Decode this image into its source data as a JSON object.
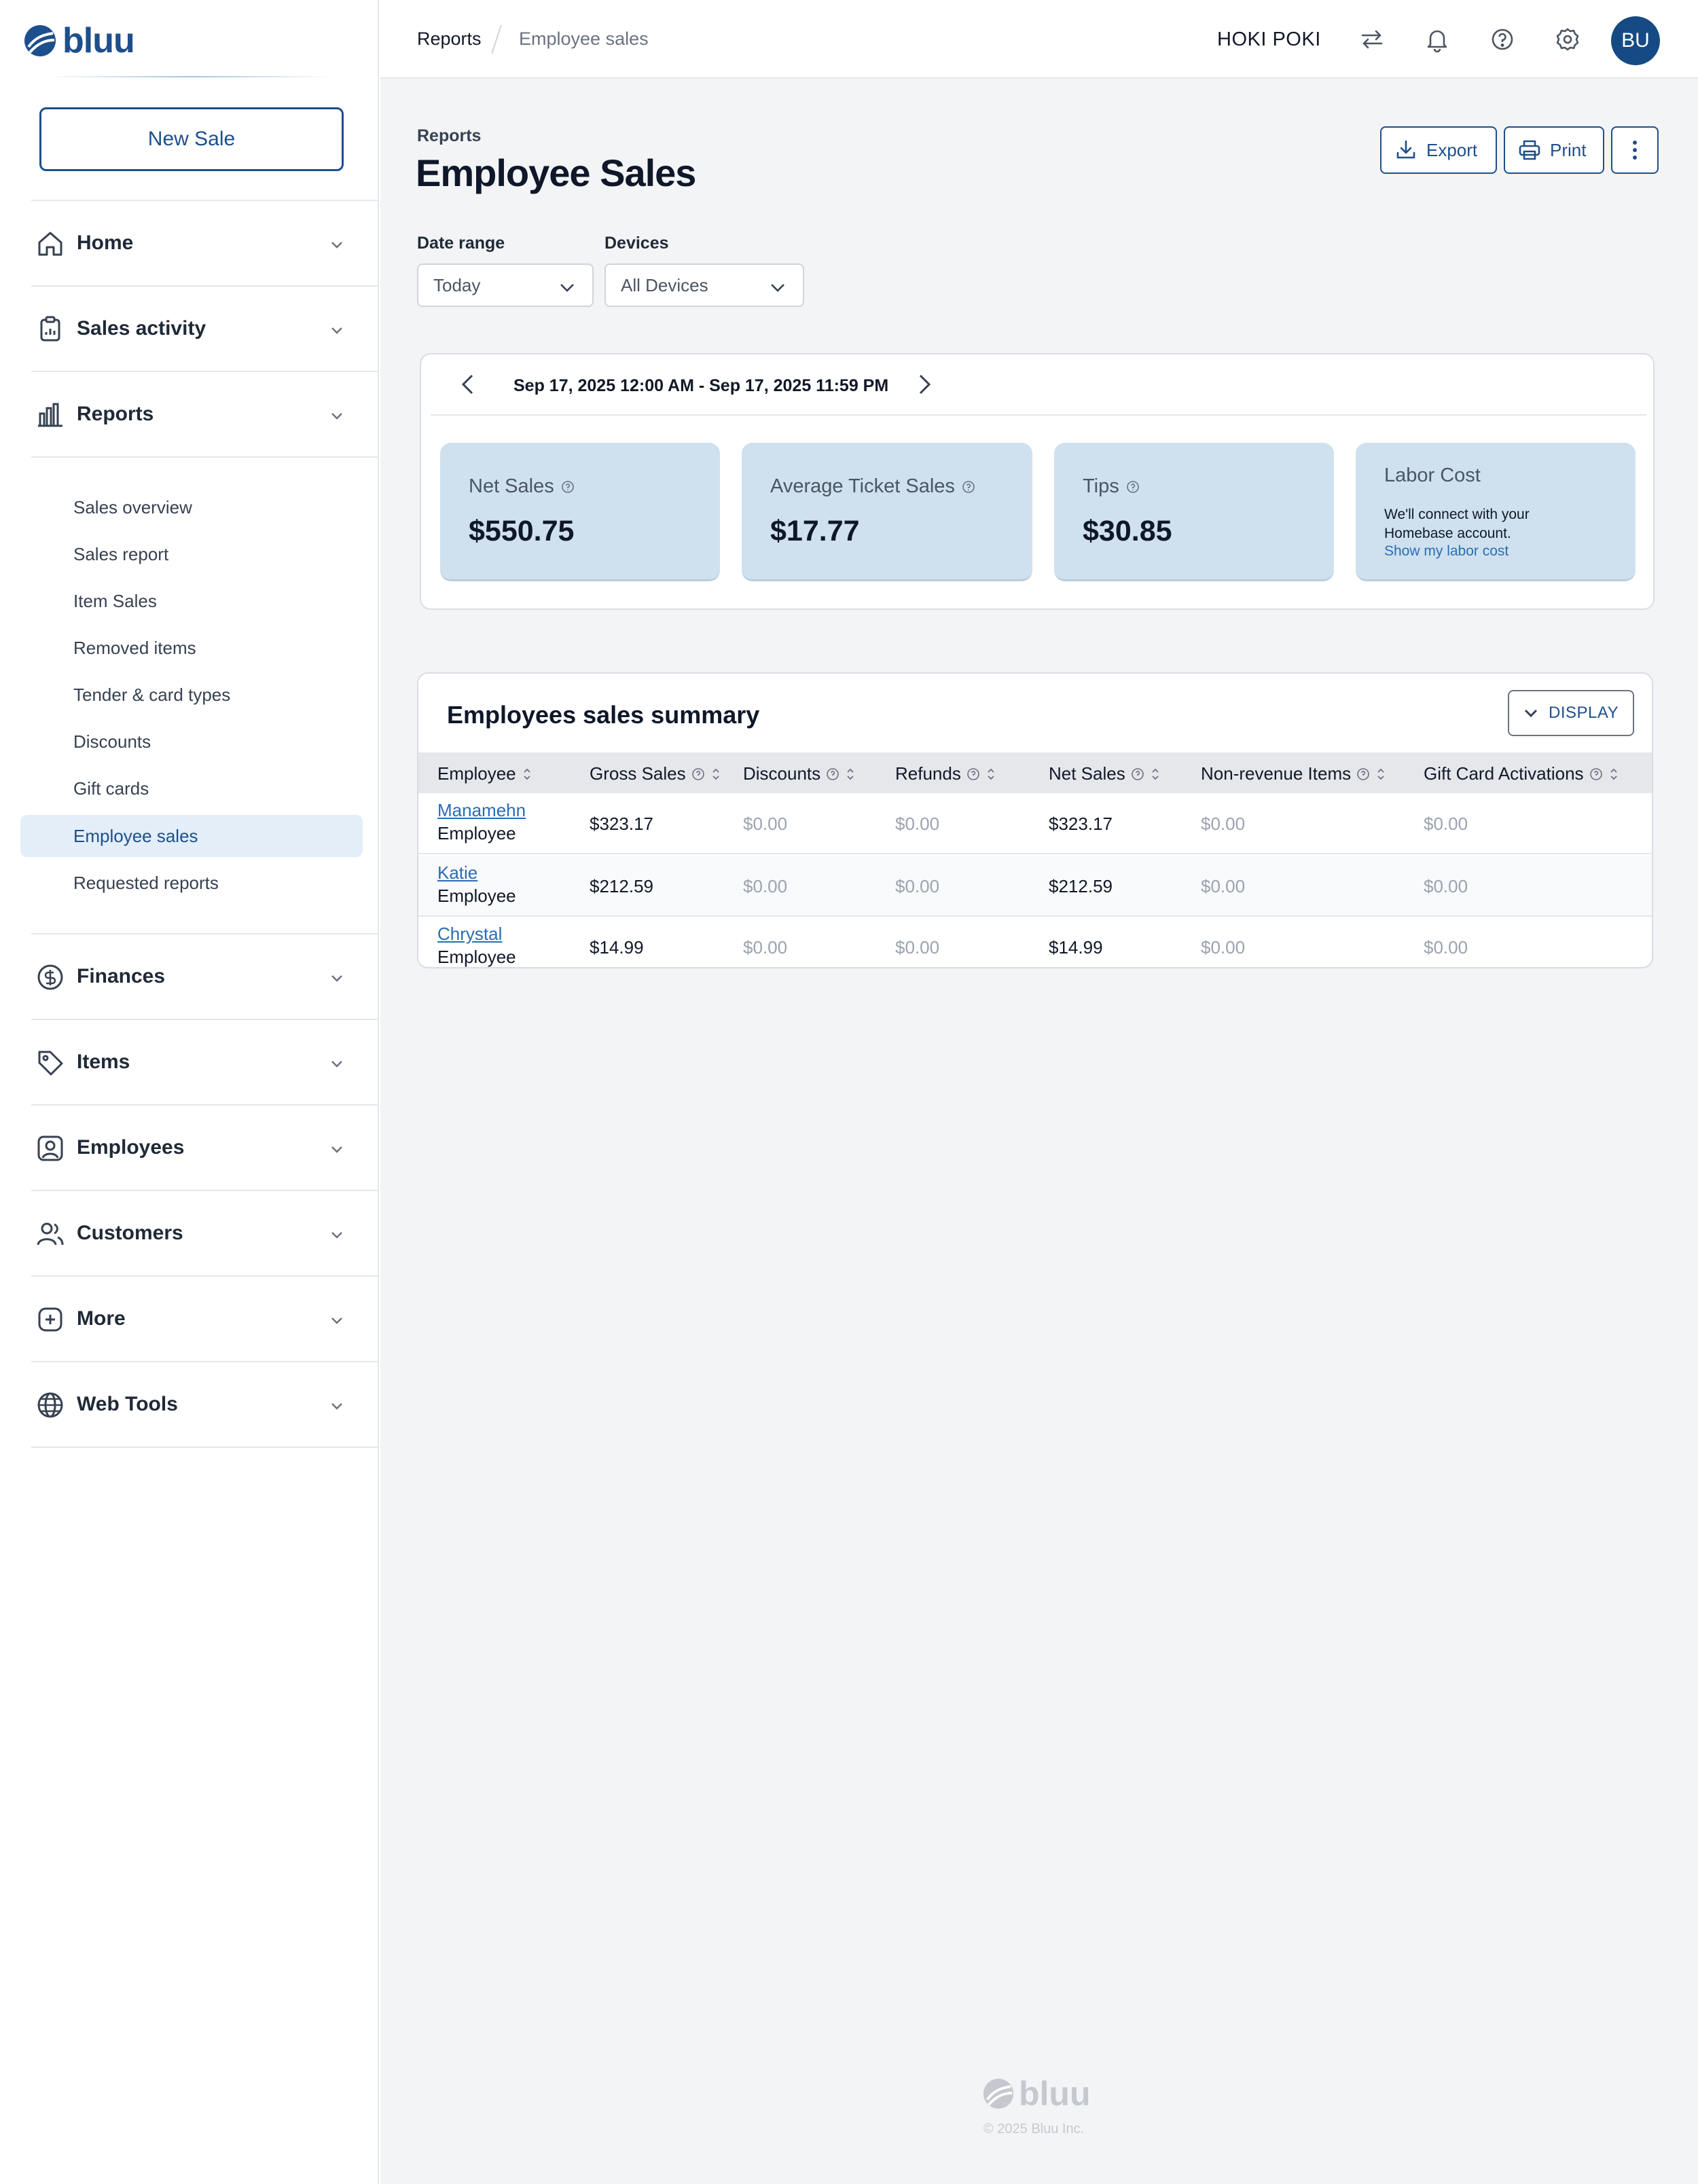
{
  "brand": {
    "name": "bluu"
  },
  "sidebar": {
    "new_sale_label": "New Sale",
    "sections": [
      {
        "label": "Home",
        "icon": "home-icon"
      },
      {
        "label": "Sales activity",
        "icon": "clipboard-icon"
      },
      {
        "label": "Reports",
        "icon": "bar-chart-icon"
      },
      {
        "label": "Finances",
        "icon": "dollar-circle-icon"
      },
      {
        "label": "Items",
        "icon": "tag-icon"
      },
      {
        "label": "Employees",
        "icon": "employee-badge-icon"
      },
      {
        "label": "Customers",
        "icon": "users-icon"
      },
      {
        "label": "More",
        "icon": "plus-square-icon"
      },
      {
        "label": "Web Tools",
        "icon": "globe-icon"
      }
    ],
    "report_items": [
      {
        "label": "Sales overview"
      },
      {
        "label": "Sales report"
      },
      {
        "label": "Item Sales"
      },
      {
        "label": "Removed items"
      },
      {
        "label": "Tender & card types"
      },
      {
        "label": "Discounts"
      },
      {
        "label": "Gift cards"
      },
      {
        "label": "Employee sales",
        "active": true
      },
      {
        "label": "Requested reports"
      }
    ]
  },
  "topbar": {
    "breadcrumb": [
      "Reports",
      "Employee sales"
    ],
    "store_name": "HOKI POKI",
    "avatar_initials": "BU",
    "icons": [
      "switch-arrows-icon",
      "bell-icon",
      "help-icon",
      "settings-icon"
    ]
  },
  "page": {
    "kicker": "Reports",
    "title": "Employee Sales",
    "actions": {
      "export": "Export",
      "print": "Print"
    }
  },
  "filters": {
    "date_range": {
      "label": "Date range",
      "value": "Today"
    },
    "devices": {
      "label": "Devices",
      "value": "All Devices"
    }
  },
  "range_text": "Sep 17, 2025 12:00 AM - Sep 17, 2025 11:59 PM",
  "metrics": [
    {
      "label": "Net Sales",
      "value": "$550.75"
    },
    {
      "label": "Average Ticket Sales",
      "value": "$17.77"
    },
    {
      "label": "Tips",
      "value": "$30.85"
    }
  ],
  "labor": {
    "title": "Labor Cost",
    "text": "We'll connect with your Homebase account.",
    "link": "Show my labor cost"
  },
  "summary": {
    "title": "Employees sales summary",
    "display_label": "DISPLAY",
    "columns": [
      "Employee",
      "Gross Sales",
      "Discounts",
      "Refunds",
      "Net Sales",
      "Non-revenue Items",
      "Gift Card Activations"
    ],
    "rows": [
      {
        "name": "Manamehn",
        "role": "Employee",
        "cells": [
          "$323.17",
          "$0.00",
          "$0.00",
          "$323.17",
          "$0.00",
          "$0.00"
        ]
      },
      {
        "name": "Katie",
        "role": "Employee",
        "cells": [
          "$212.59",
          "$0.00",
          "$0.00",
          "$212.59",
          "$0.00",
          "$0.00"
        ]
      },
      {
        "name": "Chrystal",
        "role": "Employee",
        "cells": [
          "$14.99",
          "$0.00",
          "$0.00",
          "$14.99",
          "$0.00",
          "$0.00"
        ]
      }
    ]
  },
  "footer": {
    "logo_text": "bluu",
    "copyright": "© 2025 Bluu Inc."
  },
  "colors": {
    "brand": "#1d4f8c",
    "link": "#2a6db5",
    "metric_bg": "#cfe1ee",
    "active_bg": "#e3eef8"
  }
}
